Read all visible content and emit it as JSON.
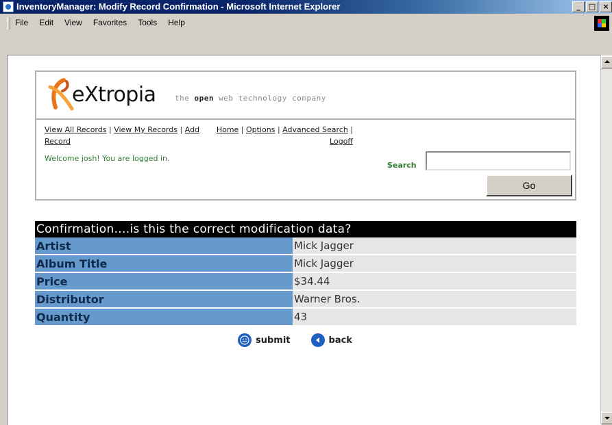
{
  "window": {
    "title": "InventoryManager: Modify Record Confirmation - Microsoft Internet Explorer",
    "buttons": {
      "minimize": "_",
      "maximize": "□",
      "close": "×"
    }
  },
  "menu": {
    "items": [
      "File",
      "Edit",
      "View",
      "Favorites",
      "Tools",
      "Help"
    ]
  },
  "header": {
    "logo_text": "eXtropia",
    "tagline_pre": "the ",
    "tagline_bold": "open",
    "tagline_post": " web technology company",
    "nav_left": {
      "view_all": "View All Records",
      "sep1": " | ",
      "view_my": "View My Records",
      "sep2": " | ",
      "add": "Add Record"
    },
    "nav_right": {
      "home": "Home",
      "sep1": " | ",
      "options": "Options",
      "sep2": " | ",
      "advanced": "Advanced Search",
      "sep3": " | ",
      "logoff": "Logoff"
    },
    "welcome": "Welcome josh! You are logged in.",
    "search_label": "Search",
    "search_value": "",
    "go_label": "Go"
  },
  "confirmation": {
    "heading": "Confirmation....is this the correct modification data?",
    "rows": [
      {
        "label": "Artist",
        "value": "Mick Jagger"
      },
      {
        "label": "Album Title",
        "value": "Mick Jagger"
      },
      {
        "label": "Price",
        "value": "$34.44"
      },
      {
        "label": "Distributor",
        "value": "Warner Bros."
      },
      {
        "label": "Quantity",
        "value": "43"
      }
    ]
  },
  "actions": {
    "submit_label": "submit",
    "back_label": "back",
    "submit_icon": "smiley-icon",
    "back_icon": "left-arrow-icon"
  },
  "colors": {
    "label_bg": "#6699cc",
    "value_bg": "#e6e6e6",
    "heading_bg": "#000000",
    "welcome_text": "#2f7d2f"
  }
}
